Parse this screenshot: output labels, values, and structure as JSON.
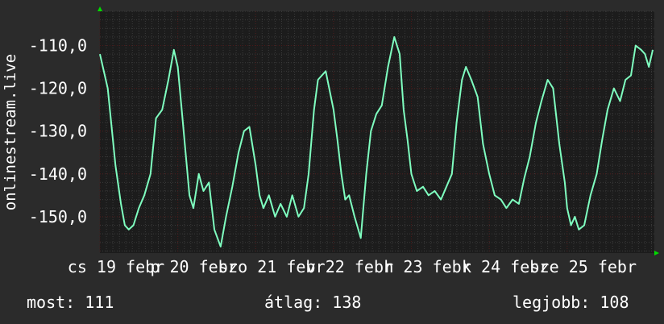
{
  "colors": {
    "background": "#2b2b2b",
    "plot_background": "#1c1c1c",
    "grid_major": "#4a1818",
    "grid_minor": "#3a3a3a",
    "line": "#7fffc0",
    "text": "#ffffff",
    "axis_arrow": "#00dd00"
  },
  "chart_data": {
    "type": "line",
    "ylabel": "onlinestream.live",
    "ylim": [
      -158.5,
      -102
    ],
    "y_ticks": [
      {
        "value": -110,
        "label": "-110,0"
      },
      {
        "value": -120,
        "label": "-120,0"
      },
      {
        "value": -130,
        "label": "-130,0"
      },
      {
        "value": -140,
        "label": "-140,0"
      },
      {
        "value": -150,
        "label": "-150,0"
      }
    ],
    "x_ticks": [
      "cs 19 febr",
      "p 20 febr",
      "szo 21 febr",
      "v 22 febr",
      "h 23 febr",
      "k 24 febr",
      "sze 25 febr"
    ],
    "xlim": [
      0,
      7.12
    ],
    "grid": true,
    "series": [
      {
        "x": [
          0.0,
          0.1,
          0.2,
          0.27,
          0.32,
          0.37,
          0.43,
          0.5,
          0.57,
          0.65,
          0.72,
          0.8,
          0.88,
          0.95,
          1.0,
          1.05,
          1.1,
          1.15,
          1.2,
          1.27,
          1.33,
          1.4,
          1.47,
          1.55,
          1.62,
          1.7,
          1.78,
          1.85,
          1.92,
          2.0,
          2.05,
          2.1,
          2.17,
          2.25,
          2.32,
          2.4,
          2.47,
          2.55,
          2.62,
          2.68,
          2.75,
          2.8,
          2.9,
          3.0,
          3.05,
          3.1,
          3.15,
          3.2,
          3.27,
          3.35,
          3.42,
          3.48,
          3.55,
          3.62,
          3.7,
          3.78,
          3.85,
          3.9,
          3.95,
          4.0,
          4.07,
          4.15,
          4.22,
          4.3,
          4.38,
          4.45,
          4.52,
          4.58,
          4.65,
          4.7,
          4.77,
          4.85,
          4.92,
          5.0,
          5.07,
          5.15,
          5.22,
          5.3,
          5.38,
          5.45,
          5.52,
          5.6,
          5.67,
          5.75,
          5.82,
          5.9,
          5.97,
          6.0,
          6.05,
          6.1,
          6.15,
          6.22,
          6.3,
          6.38,
          6.45,
          6.52,
          6.6,
          6.68,
          6.75,
          6.82,
          6.88,
          6.95,
          7.0,
          7.05,
          7.1
        ],
        "y": [
          -112,
          -120,
          -138,
          -147,
          -152,
          -153,
          -152,
          -148,
          -145,
          -140,
          -127,
          -125,
          -118,
          -111,
          -115,
          -125,
          -135,
          -145,
          -148,
          -140,
          -144,
          -142,
          -153,
          -157,
          -150,
          -143,
          -135,
          -130,
          -129,
          -138,
          -145,
          -148,
          -145,
          -150,
          -147,
          -150,
          -145,
          -150,
          -148,
          -140,
          -125,
          -118,
          -116,
          -125,
          -132,
          -140,
          -146,
          -145,
          -150,
          -155,
          -140,
          -130,
          -126,
          -124,
          -115,
          -108,
          -112,
          -125,
          -132,
          -140,
          -144,
          -143,
          -145,
          -144,
          -146,
          -143,
          -140,
          -128,
          -118,
          -115,
          -118,
          -122,
          -133,
          -140,
          -145,
          -146,
          -148,
          -146,
          -147,
          -141,
          -136,
          -128,
          -123,
          -118,
          -120,
          -133,
          -142,
          -148,
          -152,
          -150,
          -153,
          -152,
          -145,
          -140,
          -132,
          -125,
          -120,
          -123,
          -118,
          -117,
          -110,
          -111,
          -112,
          -115,
          -111
        ]
      }
    ]
  },
  "stats": {
    "current": "most: 111",
    "average": "átlag: 138",
    "best": "legjobb: 108"
  }
}
